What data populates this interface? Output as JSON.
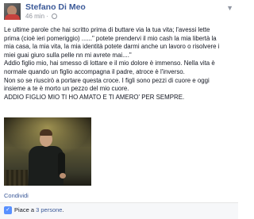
{
  "post": {
    "author": "Stefano Di Meo",
    "time": "46 min",
    "body_lines": [
      "Le ultime parole che hai scritto prima di buttare via la tua vita; l'avessi lette",
      "prima (cioè ieri pomeriggio) ......\" potete prendervi il mio cash la mia libertà la",
      "mia casa, la mia vita, la mia identità potete darmi anche un lavoro o risolvere i",
      "miei guai giuro sulla pelle nn mi avrete mai....\"",
      "Addio figlio mio, hai smesso di lottare e il mio dolore è immenso. Nella vita è",
      "normale quando un figlio accompagna il padre, atroce è l'inverso.",
      "Non so se riuscirò a portare questa croce. I figli sono pezzi di cuore e oggi",
      "insieme a te è morto un pezzo del mio cuore.",
      "ADDIO FIGLIO MIO TI HO AMATO E TI AMERO' PER SEMPRE."
    ],
    "share_label": "Condividi",
    "likes_prefix": "Piace a",
    "likes_link": "3 persone",
    "likes_suffix": "."
  },
  "icons": {
    "menu": "chevron-down-icon",
    "privacy": "globe-icon",
    "like": "thumbs-up-icon"
  },
  "colors": {
    "link": "#3b5998",
    "meta": "#90949c",
    "like_badge": "#5890ff"
  }
}
